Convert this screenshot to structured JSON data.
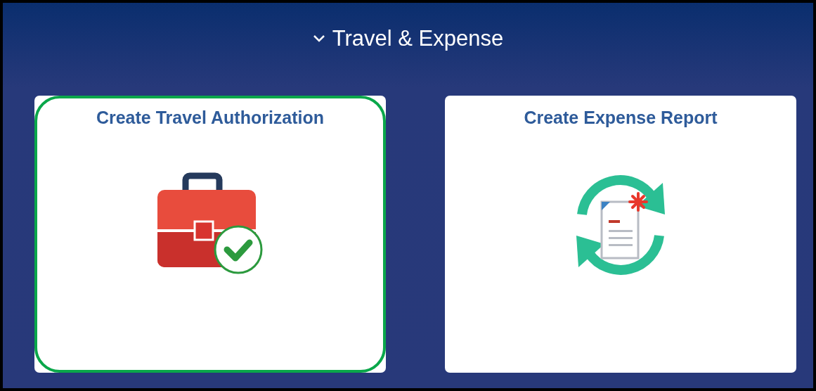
{
  "section": {
    "title": "Travel & Expense",
    "expanded": true
  },
  "tiles": [
    {
      "title": "Create Travel Authorization",
      "kind": "travel-authorization",
      "highlighted": true
    },
    {
      "title": "Create Expense Report",
      "kind": "expense-report",
      "highlighted": false
    }
  ]
}
